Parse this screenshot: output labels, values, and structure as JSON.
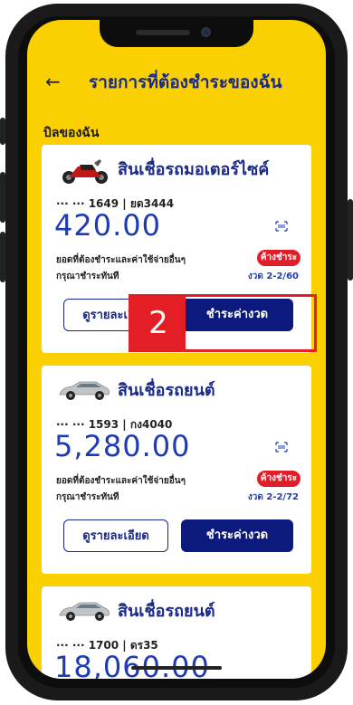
{
  "header": {
    "back_icon": "arrow-left-icon",
    "title": "รายการที่ต้องชำระของฉัน"
  },
  "section_title": "บิลของฉัน",
  "cards": [
    {
      "icon": "motorcycle-icon",
      "title": "สินเชื่อรถมอเตอร์ไซค์",
      "account": "··· ··· 1649 | ยด3444",
      "amount": "420.00",
      "due_text": "ยอดที่ต้องชำระและค่าใช้จ่ายอื่นๆ",
      "please_text": "กรุณาชำระทันที",
      "badge": "ค้างชำระ",
      "installment": "งวด 2-2/60",
      "detail_button": "ดูรายละเอียด",
      "pay_button": "ชำระค่างวด"
    },
    {
      "icon": "car-icon",
      "title": "สินเชื่อรถยนต์",
      "account": "··· ··· 1593 | กง4040",
      "amount": "5,280.00",
      "due_text": "ยอดที่ต้องชำระและค่าใช้จ่ายอื่นๆ",
      "please_text": "กรุณาชำระทันที",
      "badge": "ค้างชำระ",
      "installment": "งวด 2-2/72",
      "detail_button": "ดูรายละเอียด",
      "pay_button": "ชำระค่างวด"
    },
    {
      "icon": "car-icon",
      "title": "สินเชื่อรถยนต์",
      "account": "··· ··· 1700 | ดร35",
      "amount": "18,060.00"
    }
  ],
  "step_marker": "2",
  "colors": {
    "background": "#fbd000",
    "brand_blue": "#1a2a8a",
    "pay_button": "#0b1a7c",
    "overdue": "#e11d2a"
  }
}
